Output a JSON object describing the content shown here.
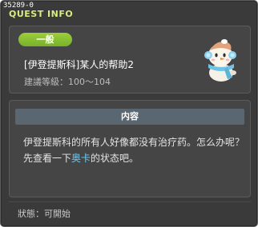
{
  "window": {
    "quest_id": "35289-0",
    "title": "QUEST INFO"
  },
  "quest": {
    "category": "一般",
    "name": "[伊登提斯科]某人的帮助2",
    "level": "建議等級：100～104",
    "npc_icon": "snowman-npc-icon"
  },
  "content": {
    "header": "内容",
    "desc_part1": "伊登提斯科的所有人好像都没有治疗药。怎么办呢？先查看一下",
    "desc_highlight": "奥卡",
    "desc_part2": "的状态吧。"
  },
  "status": {
    "text": "狀態：可開始"
  },
  "colors": {
    "title": "#d7ec7f",
    "badge": "#8cc232",
    "highlight": "#6fcbf2",
    "panel_bg": "#454545"
  }
}
